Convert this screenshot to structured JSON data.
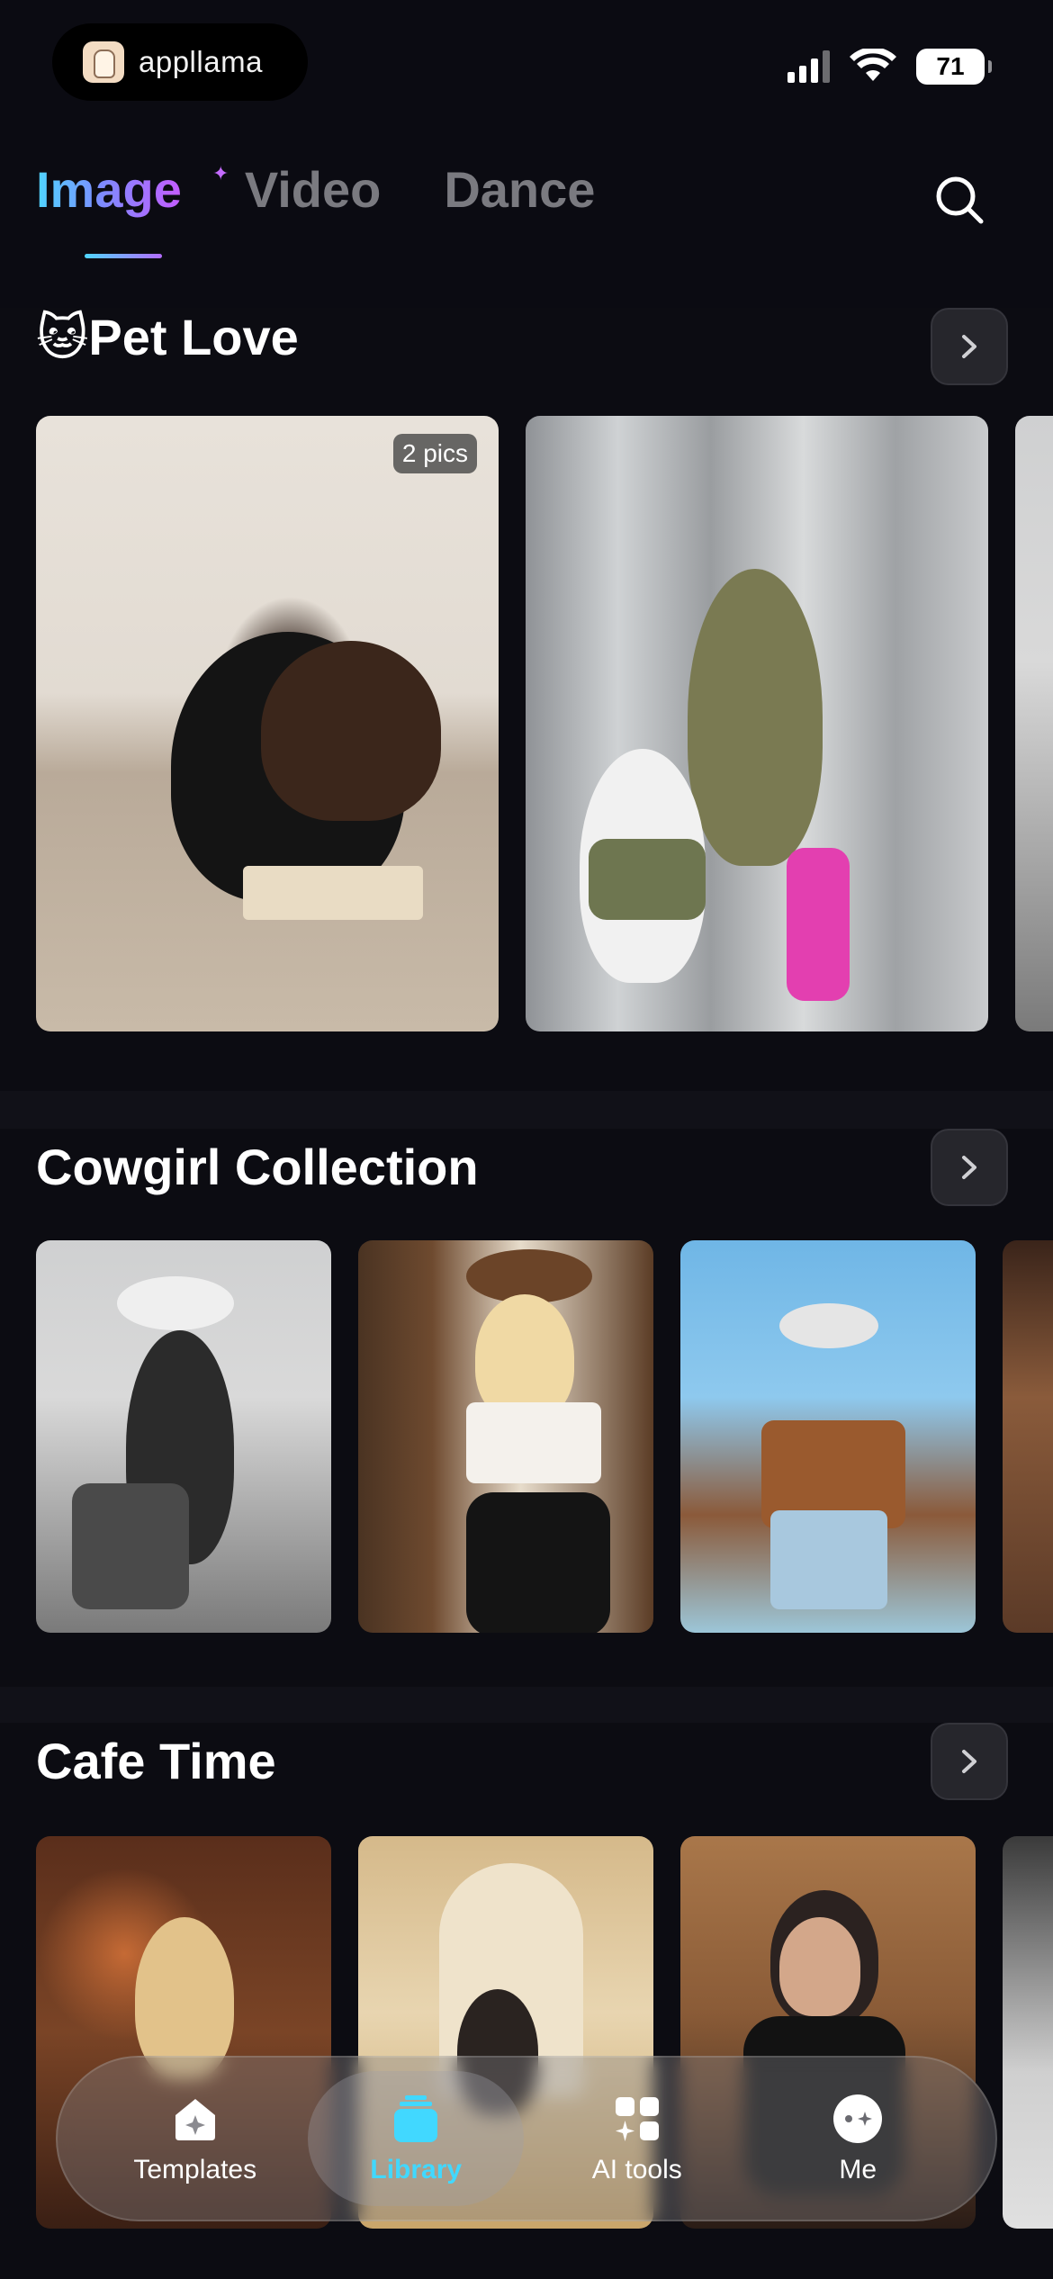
{
  "status_bar": {
    "brand_name": "appllama",
    "battery": "71"
  },
  "top_tabs": [
    {
      "label": "Image",
      "active": true
    },
    {
      "label": "Video",
      "active": false
    },
    {
      "label": "Dance",
      "active": false
    }
  ],
  "sections": [
    {
      "title": "🐱Pet Love",
      "cards": [
        {
          "badge": "2 pics"
        },
        {
          "badge": ""
        }
      ]
    },
    {
      "title": "Cowgirl Collection"
    },
    {
      "title": "Cafe Time"
    }
  ],
  "bottom_nav": [
    {
      "label": "Templates",
      "icon": "house-sparkle-icon",
      "active": false
    },
    {
      "label": "Library",
      "icon": "stack-icon",
      "active": true
    },
    {
      "label": "AI tools",
      "icon": "grid-sparkle-icon",
      "active": false
    },
    {
      "label": "Me",
      "icon": "face-sparkle-icon",
      "active": false
    }
  ],
  "colors": {
    "background": "#0c0c12",
    "accent_cyan": "#41d8ff",
    "accent_purple": "#c45cff"
  }
}
